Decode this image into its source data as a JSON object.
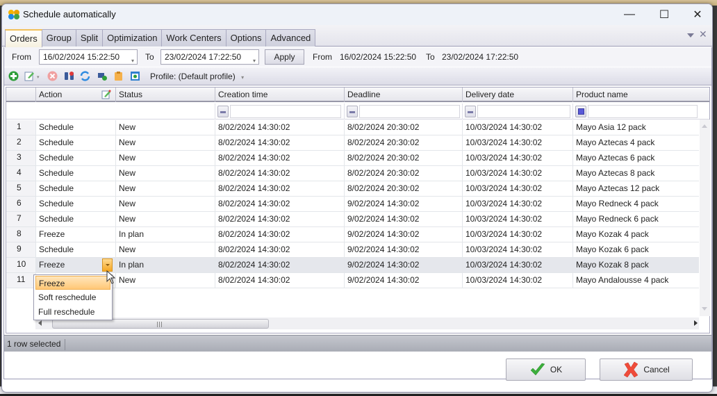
{
  "window": {
    "title": "Schedule automatically",
    "controls": {
      "minimize": "—",
      "maximize": "☐",
      "close": "✕"
    }
  },
  "tabs": [
    {
      "label": "Orders",
      "active": true
    },
    {
      "label": "Group",
      "active": false
    },
    {
      "label": "Split",
      "active": false
    },
    {
      "label": "Optimization",
      "active": false
    },
    {
      "label": "Work Centers",
      "active": false
    },
    {
      "label": "Options",
      "active": false
    },
    {
      "label": "Advanced",
      "active": false
    }
  ],
  "tab_close": "✕",
  "date_filter": {
    "from_label": "From",
    "from_value": "16/02/2024 15:22:50",
    "to_label": "To",
    "to_value": "23/02/2024 17:22:50",
    "apply_label": "Apply",
    "applied_from_label": "From",
    "applied_from_value": "16/02/2024 15:22:50",
    "applied_to_label": "To",
    "applied_to_value": "23/02/2024 17:22:50",
    "dropdown_glyph": "▾"
  },
  "toolbar": {
    "icons": [
      "add-icon",
      "edit-icon",
      "delete-icon",
      "binoculars-icon",
      "refresh-icon",
      "add-grid-icon",
      "clipboard-icon",
      "profile-window-icon"
    ],
    "profile_label": "Profile: (Default profile)",
    "dropdown_glyph": "▾"
  },
  "grid": {
    "columns": [
      "Action",
      "Status",
      "Creation time",
      "Deadline",
      "Delivery date",
      "Product name"
    ],
    "rows": [
      {
        "num": "1",
        "action": "Schedule",
        "status": "New",
        "creation": "8/02/2024 14:30:02",
        "deadline": "8/02/2024 20:30:02",
        "delivery": "10/03/2024 14:30:02",
        "product": "Mayo Asia 12 pack"
      },
      {
        "num": "2",
        "action": "Schedule",
        "status": "New",
        "creation": "8/02/2024 14:30:02",
        "deadline": "8/02/2024 20:30:02",
        "delivery": "10/03/2024 14:30:02",
        "product": "Mayo Aztecas 4 pack"
      },
      {
        "num": "3",
        "action": "Schedule",
        "status": "New",
        "creation": "8/02/2024 14:30:02",
        "deadline": "8/02/2024 20:30:02",
        "delivery": "10/03/2024 14:30:02",
        "product": "Mayo Aztecas 6 pack"
      },
      {
        "num": "4",
        "action": "Schedule",
        "status": "New",
        "creation": "8/02/2024 14:30:02",
        "deadline": "8/02/2024 20:30:02",
        "delivery": "10/03/2024 14:30:02",
        "product": "Mayo Aztecas 8 pack"
      },
      {
        "num": "5",
        "action": "Schedule",
        "status": "New",
        "creation": "8/02/2024 14:30:02",
        "deadline": "8/02/2024 20:30:02",
        "delivery": "10/03/2024 14:30:02",
        "product": "Mayo Aztecas 12 pack"
      },
      {
        "num": "6",
        "action": "Schedule",
        "status": "New",
        "creation": "8/02/2024 14:30:02",
        "deadline": "9/02/2024 14:30:02",
        "delivery": "10/03/2024 14:30:02",
        "product": "Mayo Redneck 4 pack"
      },
      {
        "num": "7",
        "action": "Schedule",
        "status": "New",
        "creation": "8/02/2024 14:30:02",
        "deadline": "9/02/2024 14:30:02",
        "delivery": "10/03/2024 14:30:02",
        "product": "Mayo Redneck 6 pack"
      },
      {
        "num": "8",
        "action": "Freeze",
        "status": "In plan",
        "creation": "8/02/2024 14:30:02",
        "deadline": "9/02/2024 14:30:02",
        "delivery": "10/03/2024 14:30:02",
        "product": "Mayo Kozak 4 pack"
      },
      {
        "num": "9",
        "action": "Schedule",
        "status": "New",
        "creation": "8/02/2024 14:30:02",
        "deadline": "9/02/2024 14:30:02",
        "delivery": "10/03/2024 14:30:02",
        "product": "Mayo Kozak 6 pack"
      },
      {
        "num": "10",
        "action": "Freeze",
        "status": "In plan",
        "creation": "8/02/2024 14:30:02",
        "deadline": "9/02/2024 14:30:02",
        "delivery": "10/03/2024 14:30:02",
        "product": "Mayo Kozak 8 pack",
        "selected": true
      },
      {
        "num": "11",
        "action": "",
        "status": "New",
        "creation": "8/02/2024 14:30:02",
        "deadline": "9/02/2024 14:30:02",
        "delivery": "10/03/2024 14:30:02",
        "product": "Mayo Andalousse 4 pack"
      }
    ]
  },
  "action_dropdown": {
    "options": [
      "Freeze",
      "Soft reschedule",
      "Full reschedule"
    ],
    "highlighted": "Freeze"
  },
  "status_bar": {
    "text": "1 row selected"
  },
  "buttons": {
    "ok": "OK",
    "cancel": "Cancel"
  }
}
